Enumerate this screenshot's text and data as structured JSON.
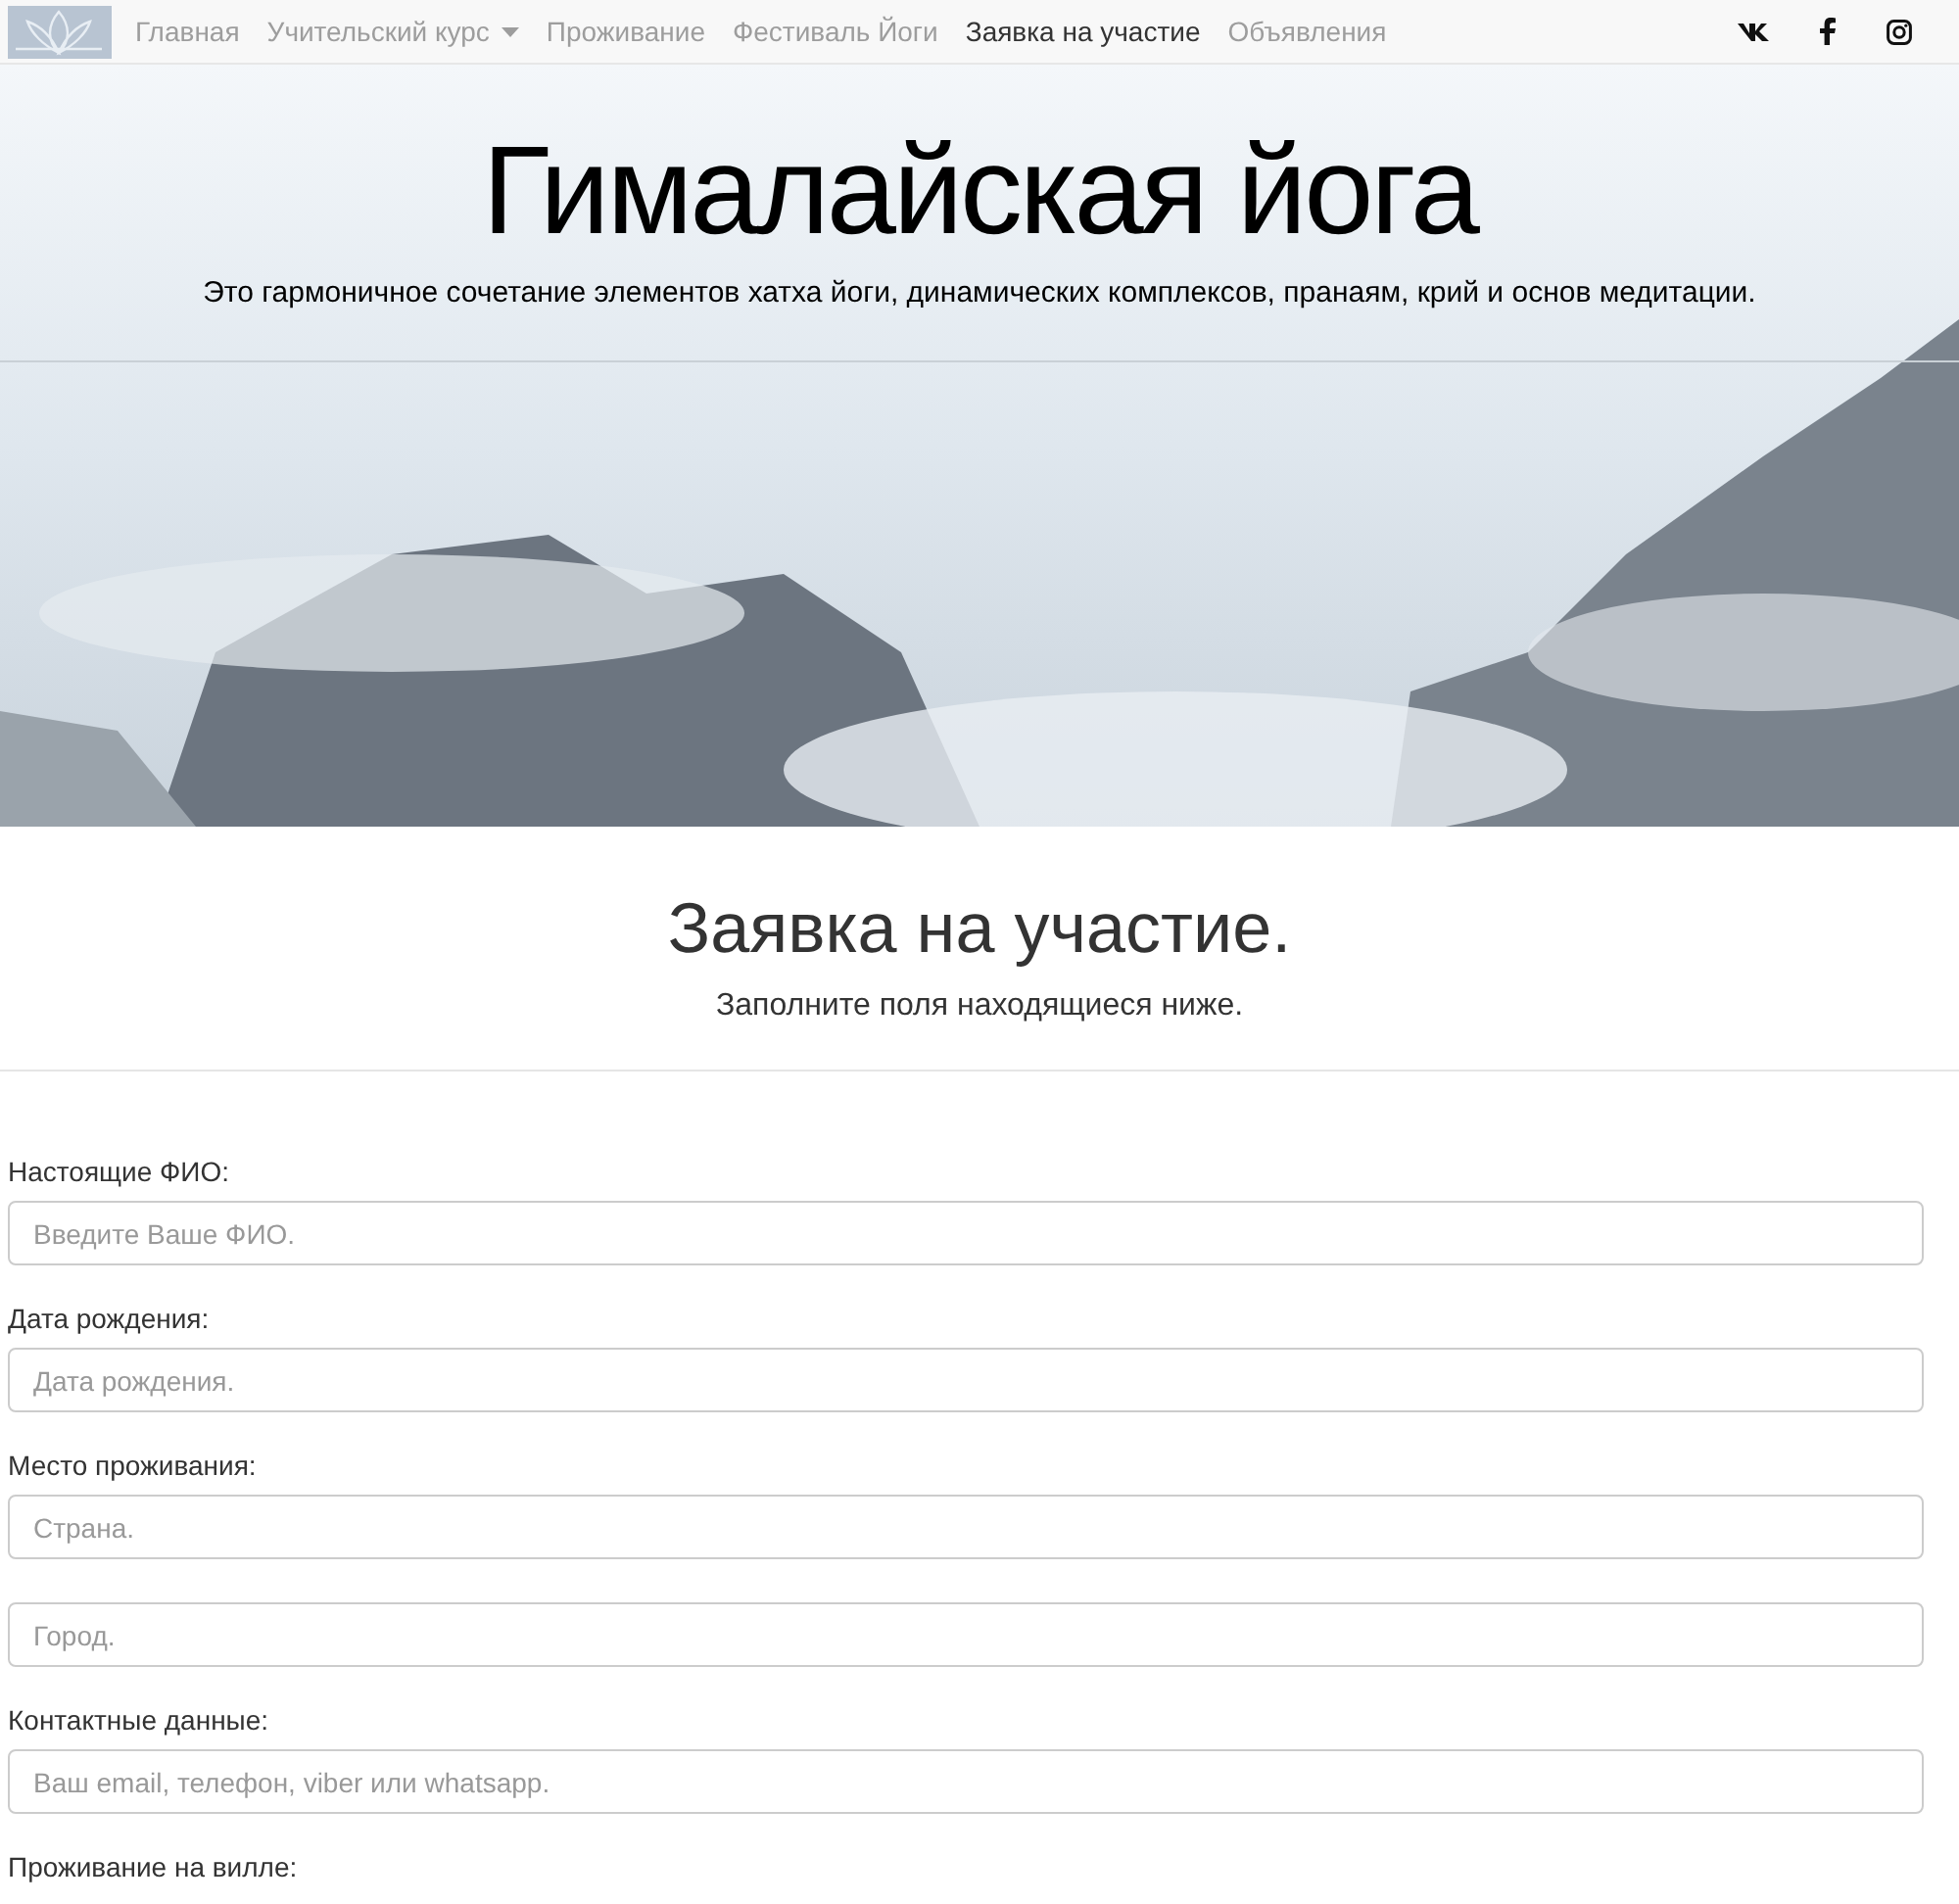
{
  "nav": {
    "items": [
      {
        "label": "Главная",
        "selected": false,
        "kind": "link"
      },
      {
        "label": "Учительский курс",
        "selected": false,
        "kind": "dropdown"
      },
      {
        "label": "Проживание",
        "selected": false,
        "kind": "link"
      },
      {
        "label": "Фестиваль Йоги",
        "selected": false,
        "kind": "link"
      },
      {
        "label": "Заявка на участие",
        "selected": true,
        "kind": "link"
      },
      {
        "label": "Объявления",
        "selected": false,
        "kind": "link"
      }
    ],
    "social": [
      {
        "kind": "vk"
      },
      {
        "kind": "facebook"
      },
      {
        "kind": "instagram"
      }
    ]
  },
  "hero": {
    "title": "Гималайская йога",
    "subtitle": "Это гармоничное сочетание элементов хатха йоги, динамических комплексов, пранаям, крий и основ медитации."
  },
  "form_header": {
    "title": "Заявка на участие.",
    "subtitle": "Заполните поля находящиеся ниже."
  },
  "form": [
    {
      "kind": "label",
      "text": "Настоящие ФИО:"
    },
    {
      "kind": "input",
      "placeholder": "Введите Ваше ФИО."
    },
    {
      "kind": "label",
      "text": "Дата рождения:"
    },
    {
      "kind": "input",
      "placeholder": "Дата рождения."
    },
    {
      "kind": "label",
      "text": "Место проживания:"
    },
    {
      "kind": "input",
      "placeholder": "Страна."
    },
    {
      "kind": "input",
      "placeholder": "Город."
    },
    {
      "kind": "label",
      "text": "Контактные данные:"
    },
    {
      "kind": "input",
      "placeholder": "Ваш email, телефон, viber или whatsapp."
    },
    {
      "kind": "label",
      "text": "Проживание на вилле:"
    }
  ]
}
